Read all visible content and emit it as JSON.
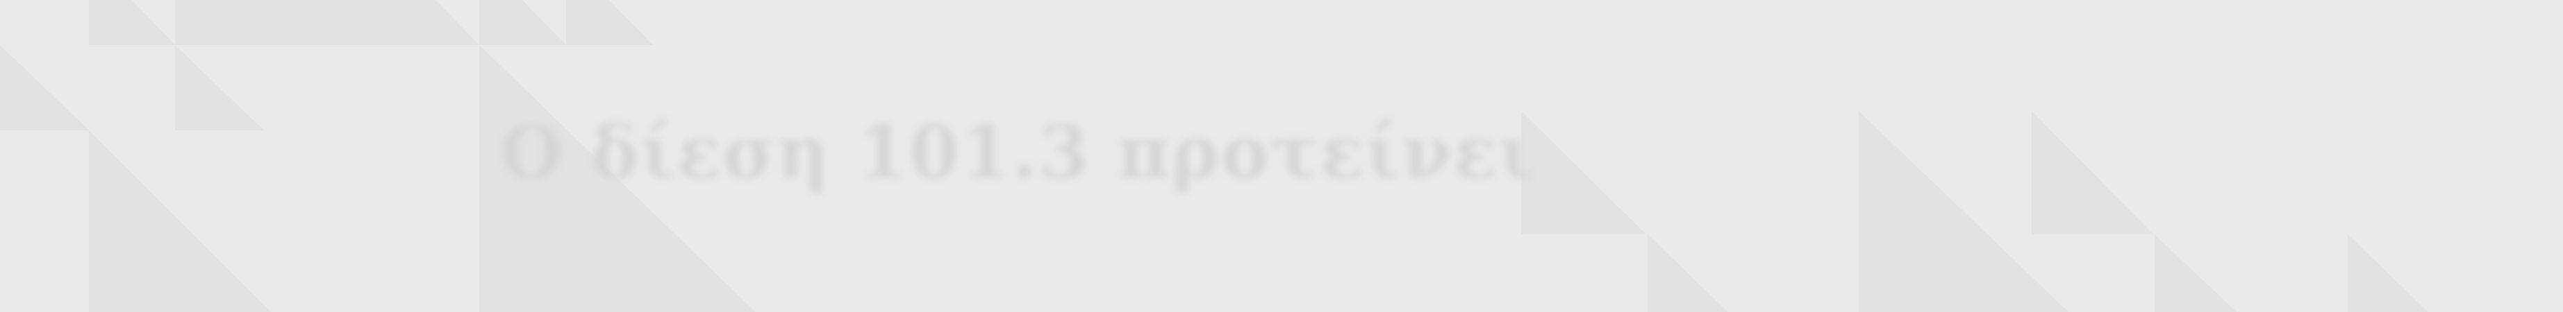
{
  "banner": {
    "title": "Ο δίεση 101.3 προτείνει",
    "background_color": "#e9eae9",
    "pattern_color": "#e1e3e1",
    "title_color": "#d2d3d2"
  }
}
